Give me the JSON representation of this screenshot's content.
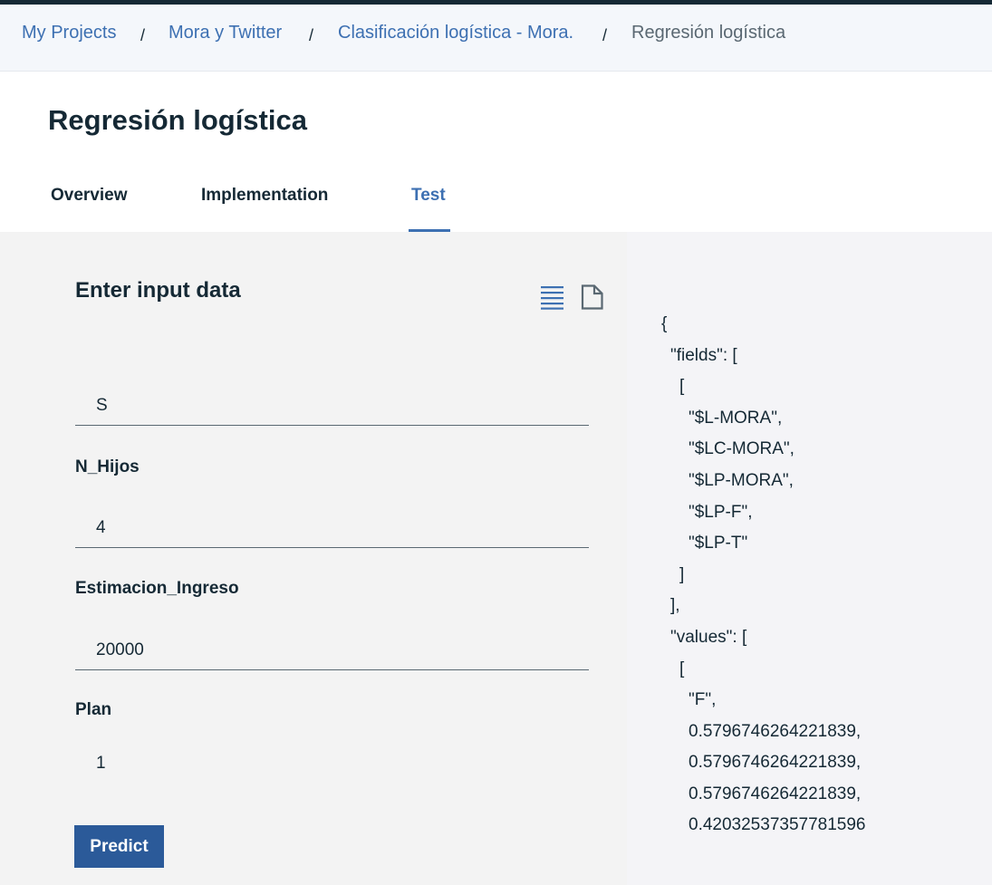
{
  "breadcrumb": {
    "items": [
      {
        "label": "My Projects"
      },
      {
        "label": "Mora y Twitter"
      },
      {
        "label": "Clasificación logística - Mora."
      },
      {
        "label": "Regresión logística"
      }
    ],
    "separator": "/"
  },
  "header": {
    "title": "Regresión logística",
    "tabs": [
      {
        "label": "Overview"
      },
      {
        "label": "Implementation"
      },
      {
        "label": "Test",
        "active": true
      }
    ]
  },
  "input_panel": {
    "title": "Enter input data",
    "icons": [
      "list-view-icon",
      "document-icon"
    ],
    "fields": [
      {
        "label": "",
        "value": "S"
      },
      {
        "label": "N_Hijos",
        "value": "4"
      },
      {
        "label": "Estimacion_Ingreso",
        "value": "20000"
      },
      {
        "label": "Plan",
        "value": "1"
      }
    ],
    "predict_label": "Predict"
  },
  "json_panel": {
    "lines": [
      "{",
      "\"fields\": [",
      "[",
      "\"$L-MORA\",",
      "\"$LC-MORA\",",
      "\"$LP-MORA\",",
      "\"$LP-F\",",
      "\"$LP-T\"",
      "]",
      "],",
      "\"values\": [",
      "[",
      "\"F\",",
      "0.5796746264221839,",
      "0.5796746264221839,",
      "0.5796746264221839,",
      "0.42032537357781596"
    ]
  },
  "colors": {
    "accent": "#3d70b2",
    "button": "#2b5a99",
    "text": "#152935",
    "topbar": "#152935"
  }
}
